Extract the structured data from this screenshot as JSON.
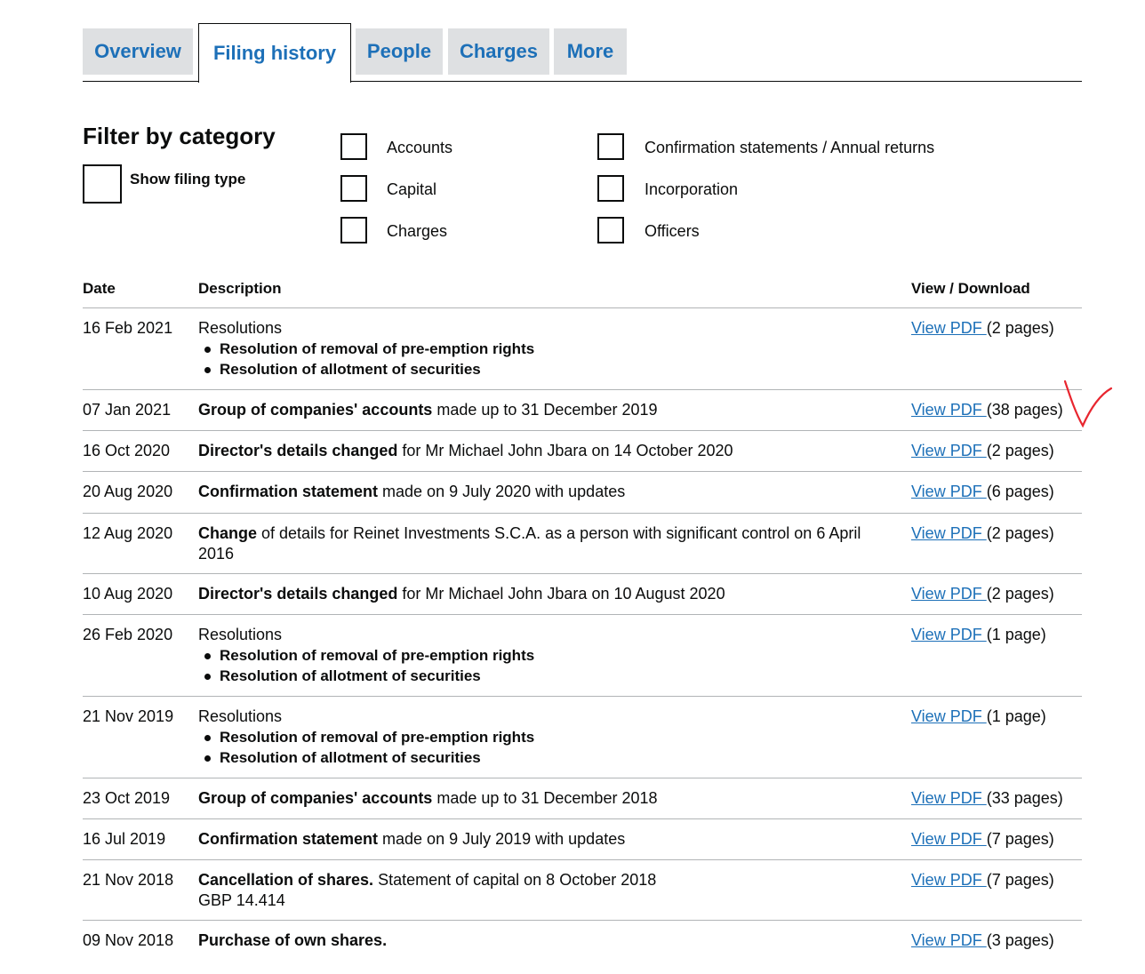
{
  "tabs": [
    {
      "label": "Overview",
      "active": false
    },
    {
      "label": "Filing history",
      "active": true
    },
    {
      "label": "People",
      "active": false
    },
    {
      "label": "Charges",
      "active": false
    },
    {
      "label": "More",
      "active": false
    }
  ],
  "filter": {
    "title": "Filter by category",
    "show_filing_type": "Show filing type",
    "categories": [
      "Accounts",
      "Capital",
      "Charges",
      "Confirmation statements / Annual returns",
      "Incorporation",
      "Officers"
    ]
  },
  "table": {
    "headers": {
      "date": "Date",
      "description": "Description",
      "view": "View / Download"
    },
    "link_text": "View PDF ",
    "rows": [
      {
        "date": "16 Feb 2021",
        "bold": "",
        "text": "Resolutions",
        "subs": [
          "Resolution of removal of pre-emption rights",
          "Resolution of allotment of securities"
        ],
        "pages": "(2 pages)"
      },
      {
        "date": "07 Jan 2021",
        "bold": "Group of companies' accounts",
        "text": " made up to 31 December 2019",
        "subs": [],
        "pages": "(38 pages)"
      },
      {
        "date": "16 Oct 2020",
        "bold": "Director's details changed",
        "text": " for Mr Michael John Jbara on 14 October 2020",
        "subs": [],
        "pages": "(2 pages)"
      },
      {
        "date": "20 Aug 2020",
        "bold": "Confirmation statement",
        "text": " made on 9 July 2020 with updates",
        "subs": [],
        "pages": "(6 pages)"
      },
      {
        "date": "12 Aug 2020",
        "bold": "Change",
        "text": " of details for Reinet Investments S.C.A. as a person with significant control on 6 April 2016",
        "subs": [],
        "pages": "(2 pages)"
      },
      {
        "date": "10 Aug 2020",
        "bold": "Director's details changed",
        "text": " for Mr Michael John Jbara on 10 August 2020",
        "subs": [],
        "pages": "(2 pages)"
      },
      {
        "date": "26 Feb 2020",
        "bold": "",
        "text": "Resolutions",
        "subs": [
          "Resolution of removal of pre-emption rights",
          "Resolution of allotment of securities"
        ],
        "pages": "(1 page)"
      },
      {
        "date": "21 Nov 2019",
        "bold": "",
        "text": "Resolutions",
        "subs": [
          "Resolution of removal of pre-emption rights",
          "Resolution of allotment of securities"
        ],
        "pages": "(1 page)"
      },
      {
        "date": "23 Oct 2019",
        "bold": "Group of companies' accounts",
        "text": " made up to 31 December 2018",
        "subs": [],
        "pages": "(33 pages)"
      },
      {
        "date": "16 Jul 2019",
        "bold": "Confirmation statement",
        "text": " made on 9 July 2019 with updates",
        "subs": [],
        "pages": "(7 pages)"
      },
      {
        "date": "21 Nov 2018",
        "bold": "Cancellation of shares.",
        "text": " Statement of capital on 8 October 2018",
        "extra": "GBP 14.414",
        "subs": [],
        "pages": "(7 pages)"
      },
      {
        "date": "09 Nov 2018",
        "bold": "Purchase of own shares.",
        "text": "",
        "subs": [],
        "pages": "(3 pages)"
      }
    ]
  },
  "colors": {
    "link": "#1d70b8",
    "tab_bg": "#dee0e2",
    "tick": "#e8262f"
  }
}
